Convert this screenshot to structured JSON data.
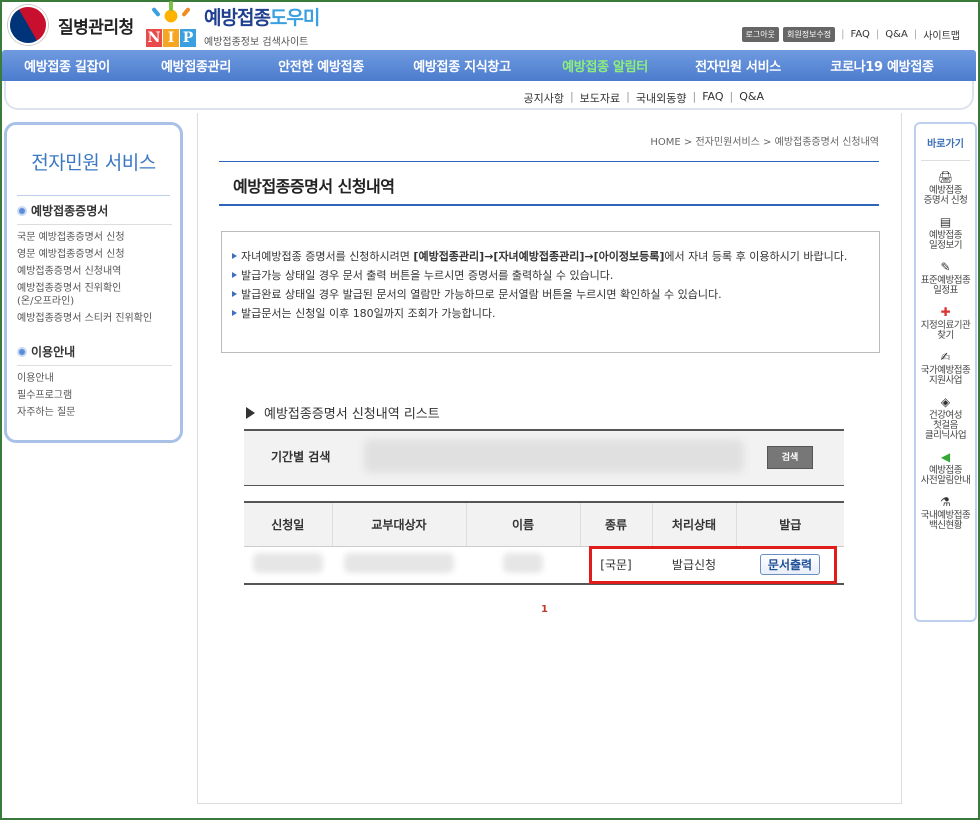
{
  "header": {
    "agency_name": "질병관리청",
    "site_title_main": "예방접종",
    "site_title_accent": "도우미",
    "site_subtitle": "예방접종정보 검색사이트",
    "nip_letters": [
      "N",
      "I",
      "P"
    ]
  },
  "top_util": {
    "logout": "로그아웃",
    "edit_info": "회원정보수정",
    "faq": "FAQ",
    "qna": "Q&A",
    "sitemap": "사이트맵"
  },
  "gnb": [
    {
      "label": "예방접종 길잡이"
    },
    {
      "label": "예방접종관리"
    },
    {
      "label": "안전한 예방접종"
    },
    {
      "label": "예방접종 지식창고"
    },
    {
      "label": "예방접종 알림터"
    },
    {
      "label": "전자민원 서비스"
    },
    {
      "label": "코로나19 예방접종"
    }
  ],
  "subnav": [
    "공지사항",
    "보도자료",
    "국내외동향",
    "FAQ",
    "Q&A"
  ],
  "lnb": {
    "title": "전자민원 서비스",
    "section1": "예방접종증명서",
    "section1_items": [
      "국문 예방접종증명서 신청",
      "영문 예방접종증명서 신청",
      "예방접종증명서 신청내역",
      "예방접종증명서 진위확인\n(온/오프라인)",
      "예방접종증명서 스티커 진위확인"
    ],
    "section2": "이용안내",
    "section2_items": [
      "이용안내",
      "필수프로그램",
      "자주하는 질문"
    ]
  },
  "breadcrumb": "HOME > 전자민원서비스 > 예방접종증명서 신청내역",
  "page_title": "예방접종증명서 신청내역",
  "notices": {
    "n1_pre": "자녀예방접종 증명서를 신청하시려면 ",
    "n1_bold": "[예방접종관리]→[자녀예방접종관리]→[아이정보등록]",
    "n1_post": "에서 자녀 등록 후 이용하시기 바랍니다.",
    "n2": "발급가능 상태일 경우 문서 출력 버튼을 누르시면 증명서를 출력하실 수 있습니다.",
    "n3": "발급완료 상태일 경우 발급된 문서의 열람만 가능하므로 문서열람 버튼을 누르시면 확인하실 수 있습니다.",
    "n4": "발급문서는 신청일 이후 180일까지 조회가 가능합니다."
  },
  "list_title": "예방접종증명서 신청내역 리스트",
  "search": {
    "label": "기간별 검색",
    "button": "검색"
  },
  "table": {
    "headers": [
      "신청일",
      "교부대상자",
      "이름",
      "종류",
      "처리상태",
      "발급"
    ],
    "row": {
      "type": "[국문]",
      "status": "발급신청",
      "action": "문서출력"
    }
  },
  "pager": "1",
  "quick": {
    "title": "바로가기",
    "items": [
      {
        "label": "예방접종\n증명서 신청",
        "icon": "printer-icon"
      },
      {
        "label": "예방접종\n일정보기",
        "icon": "calendar-icon"
      },
      {
        "label": "표준예방접종\n일정표",
        "icon": "syringe-icon"
      },
      {
        "label": "지정의료기관\n찾기",
        "icon": "hospital-icon"
      },
      {
        "label": "국가예방접종\n지원사업",
        "icon": "document-icon"
      },
      {
        "label": "건강여성\n첫걸음\n클리닉사업",
        "icon": "box-icon"
      },
      {
        "label": "예방접종\n사전알림안내",
        "icon": "speaker-icon"
      },
      {
        "label": "국내예방접종\n백신현황",
        "icon": "vaccine-icon"
      }
    ]
  }
}
